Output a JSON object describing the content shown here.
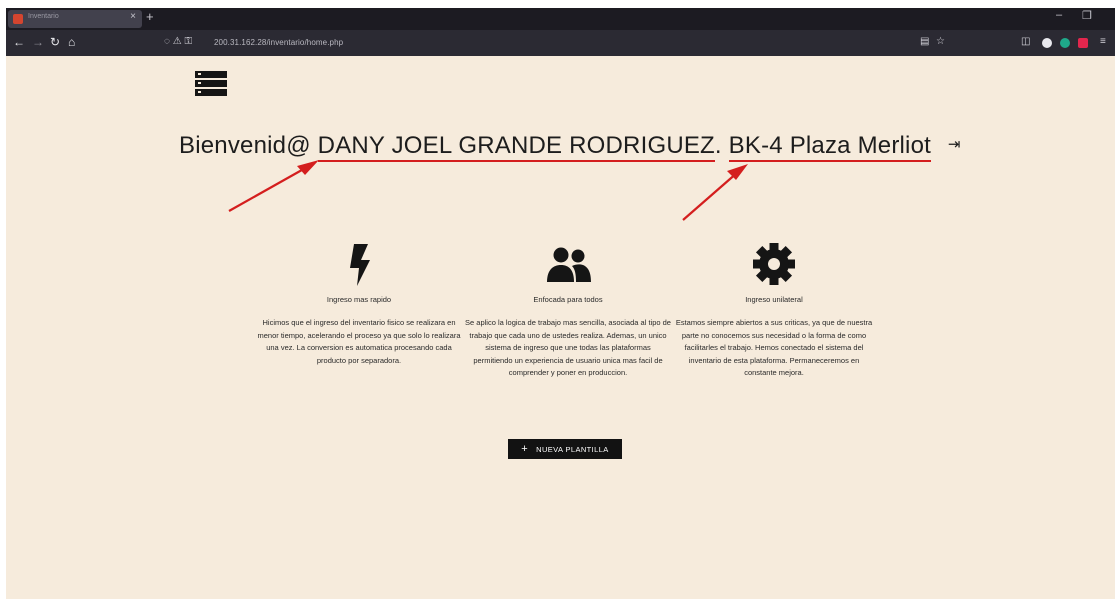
{
  "browser": {
    "tab_title": "Inventario",
    "tab_close": "×",
    "new_tab": "+",
    "address": "200.31.162.28/inventario/home.php",
    "window_minimize": "–",
    "window_restore": "❐"
  },
  "header": {
    "greeting": "Bienvenid@",
    "user_name": "DANY JOEL GRANDE RODRIGUEZ",
    "separator": ".",
    "location": "BK-4 Plaza Merliot",
    "logout_glyph": "⇥"
  },
  "features": [
    {
      "icon": "bolt-icon",
      "title": "Ingreso mas rapido",
      "text": "Hicimos que el ingreso del inventario fisico se realizara en menor tiempo, acelerando el proceso ya que solo lo realizara una vez. La conversion es automatica procesando cada producto por separadora."
    },
    {
      "icon": "users-icon",
      "title": "Enfocada para todos",
      "text": "Se aplico la logica de trabajo mas sencilla, asociada al tipo de trabajo que cada uno de ustedes realiza. Ademas, un unico sistema de ingreso que une todas las plataformas permitiendo un experiencia de usuario unica mas facil de comprender y poner en produccion."
    },
    {
      "icon": "gear-icon",
      "title": "Ingreso unilateral",
      "text": "Estamos siempre abiertos a sus criticas, ya que de nuestra parte no conocemos sus necesidad o la forma de como facilitarles el trabajo. Hemos conectado el sistema del inventario de esta plataforma. Permaneceremos en constante mejora."
    }
  ],
  "actions": {
    "new_template_plus": "+",
    "new_template_label": "NUEVA PLANTILLA"
  },
  "colors": {
    "page_background": "#f6ebdc",
    "annotation_red": "#d41e1e",
    "button_background": "#121212"
  }
}
